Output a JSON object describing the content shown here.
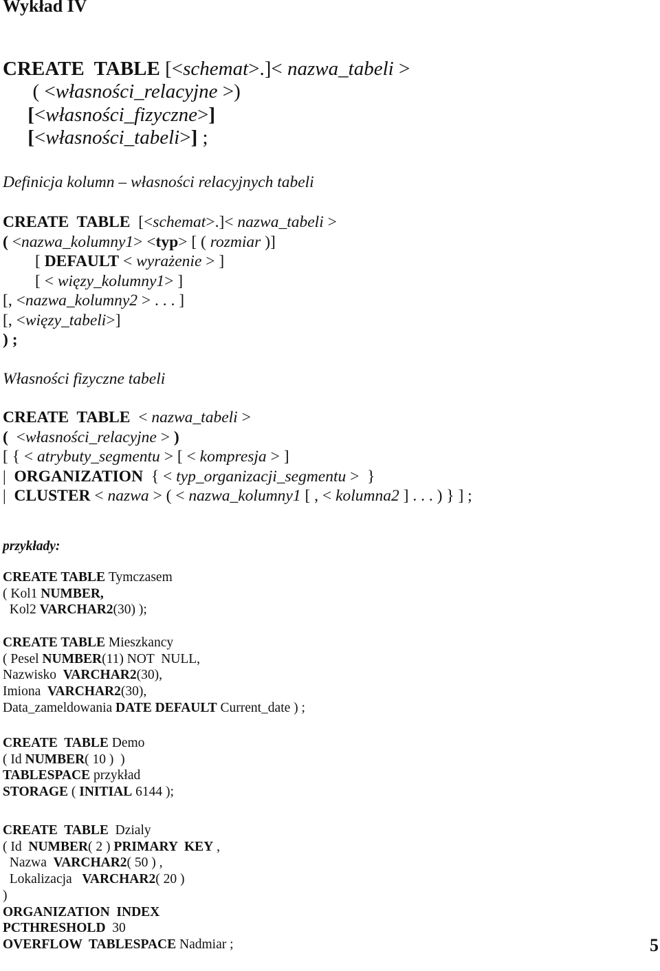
{
  "title": "Wykład IV",
  "page_number": "5",
  "section1": {
    "lines": [
      [
        {
          "t": "CREATE  TABLE ",
          "s": "b"
        },
        {
          "t": "[<",
          "s": ""
        },
        {
          "t": "schemat",
          "s": "i"
        },
        {
          "t": ">.]< ",
          "s": ""
        },
        {
          "t": "nazwa_tabeli",
          "s": "i"
        },
        {
          "t": " >",
          "s": ""
        }
      ],
      [
        {
          "t": "      ( <",
          "s": ""
        },
        {
          "t": "własności_relacyjne",
          "s": "i"
        },
        {
          "t": " >)",
          "s": ""
        }
      ],
      [
        {
          "t": "     [",
          "s": "b"
        },
        {
          "t": "<",
          "s": ""
        },
        {
          "t": "własności_fizyczne",
          "s": "i"
        },
        {
          "t": ">",
          "s": ""
        },
        {
          "t": "]",
          "s": "b"
        }
      ],
      [
        {
          "t": "     [",
          "s": "b"
        },
        {
          "t": "<",
          "s": ""
        },
        {
          "t": "własności_tabeli",
          "s": "i"
        },
        {
          "t": ">",
          "s": ""
        },
        {
          "t": "]",
          "s": "b"
        },
        {
          "t": " ;",
          "s": ""
        }
      ]
    ]
  },
  "section2": {
    "heading": "Definicja kolumn – własności relacyjnych tabeli",
    "lines": [
      [
        {
          "t": "CREATE  TABLE  ",
          "s": "b"
        },
        {
          "t": "[<",
          "s": ""
        },
        {
          "t": "schemat",
          "s": "i"
        },
        {
          "t": ">.]< ",
          "s": ""
        },
        {
          "t": "nazwa_tabeli",
          "s": "i"
        },
        {
          "t": " >",
          "s": ""
        }
      ],
      [
        {
          "t": "( ",
          "s": "b"
        },
        {
          "t": "<",
          "s": ""
        },
        {
          "t": "nazwa_kolumny1",
          "s": "i"
        },
        {
          "t": "> <",
          "s": ""
        },
        {
          "t": "typ",
          "s": "b"
        },
        {
          "t": "> [ ( ",
          "s": ""
        },
        {
          "t": "rozmiar",
          "s": "i"
        },
        {
          "t": " )]",
          "s": ""
        }
      ],
      [
        {
          "t": "        [ ",
          "s": ""
        },
        {
          "t": "DEFAULT",
          "s": "b"
        },
        {
          "t": " < ",
          "s": ""
        },
        {
          "t": "wyrażenie",
          "s": "i"
        },
        {
          "t": " > ]",
          "s": ""
        }
      ],
      [
        {
          "t": "        [ < ",
          "s": ""
        },
        {
          "t": "więzy_kolumny1",
          "s": "i"
        },
        {
          "t": "> ]",
          "s": ""
        }
      ],
      [
        {
          "t": "[, <",
          "s": ""
        },
        {
          "t": "nazwa_kolumny2",
          "s": "i"
        },
        {
          "t": " > . . . ]",
          "s": ""
        }
      ],
      [
        {
          "t": "[, <",
          "s": ""
        },
        {
          "t": "więzy_tabeli",
          "s": "i"
        },
        {
          "t": ">]",
          "s": ""
        }
      ],
      [
        {
          "t": ") ;",
          "s": "b"
        }
      ]
    ]
  },
  "section3": {
    "heading": "Własności fizyczne tabeli",
    "lines": [
      [
        {
          "t": "CREATE  TABLE  ",
          "s": "b"
        },
        {
          "t": "< ",
          "s": ""
        },
        {
          "t": "nazwa_tabeli",
          "s": "i"
        },
        {
          "t": " >",
          "s": ""
        }
      ],
      [
        {
          "t": "(  ",
          "s": "b"
        },
        {
          "t": "<",
          "s": ""
        },
        {
          "t": "własności_relacyjne",
          "s": "i"
        },
        {
          "t": " > ",
          "s": ""
        },
        {
          "t": ")",
          "s": "b"
        }
      ],
      [
        {
          "t": "[ { < ",
          "s": ""
        },
        {
          "t": "atrybuty_segmentu",
          "s": "i"
        },
        {
          "t": " > [ < ",
          "s": ""
        },
        {
          "t": "kompresja",
          "s": "i"
        },
        {
          "t": " > ]",
          "s": ""
        }
      ],
      [
        {
          "t": "|  ",
          "s": ""
        },
        {
          "t": "ORGANIZATION",
          "s": "b"
        },
        {
          "t": "  { < ",
          "s": ""
        },
        {
          "t": "typ_organizacji_segmentu",
          "s": "i"
        },
        {
          "t": " >  }",
          "s": ""
        }
      ],
      [
        {
          "t": "|  ",
          "s": ""
        },
        {
          "t": "CLUSTER",
          "s": "b"
        },
        {
          "t": " < ",
          "s": ""
        },
        {
          "t": "nazwa",
          "s": "i"
        },
        {
          "t": " > ( < ",
          "s": ""
        },
        {
          "t": "nazwa_kolumny1",
          "s": "i"
        },
        {
          "t": " [ , < ",
          "s": ""
        },
        {
          "t": "kolumna2",
          "s": "i"
        },
        {
          "t": " ] . . . ) } ] ;",
          "s": ""
        }
      ]
    ]
  },
  "examples": {
    "heading": "przykłady:",
    "blocks": [
      [
        [
          {
            "t": "CREATE TABLE ",
            "s": "b"
          },
          {
            "t": "Tymczasem",
            "s": ""
          }
        ],
        [
          {
            "t": "( Kol1 ",
            "s": ""
          },
          {
            "t": "NUMBER,",
            "s": "b"
          }
        ],
        [
          {
            "t": "  Kol2 ",
            "s": ""
          },
          {
            "t": "VARCHAR2",
            "s": "b"
          },
          {
            "t": "(30) );",
            "s": ""
          }
        ]
      ],
      [
        [
          {
            "t": "CREATE TABLE ",
            "s": "b"
          },
          {
            "t": "Mieszkancy",
            "s": ""
          }
        ],
        [
          {
            "t": "( Pesel ",
            "s": ""
          },
          {
            "t": "NUMBER",
            "s": "b"
          },
          {
            "t": "(11) NOT  NULL,",
            "s": ""
          }
        ],
        [
          {
            "t": "Nazwisko  ",
            "s": ""
          },
          {
            "t": "VARCHAR2",
            "s": "b"
          },
          {
            "t": "(30),",
            "s": ""
          }
        ],
        [
          {
            "t": "Imiona  ",
            "s": ""
          },
          {
            "t": "VARCHAR2",
            "s": "b"
          },
          {
            "t": "(30),",
            "s": ""
          }
        ],
        [
          {
            "t": "Data_zameldowania ",
            "s": ""
          },
          {
            "t": "DATE DEFAULT",
            "s": "b"
          },
          {
            "t": " Current_date ) ;",
            "s": ""
          }
        ]
      ],
      [
        [
          {
            "t": "CREATE  TABLE ",
            "s": "b"
          },
          {
            "t": "Demo",
            "s": ""
          }
        ],
        [
          {
            "t": "( Id ",
            "s": ""
          },
          {
            "t": "NUMBER",
            "s": "b"
          },
          {
            "t": "( 10 )  )",
            "s": ""
          }
        ],
        [
          {
            "t": "TABLESPACE",
            "s": "b"
          },
          {
            "t": " przykład",
            "s": ""
          }
        ],
        [
          {
            "t": "STORAGE",
            "s": "b"
          },
          {
            "t": " ( ",
            "s": ""
          },
          {
            "t": "INITIAL",
            "s": "b"
          },
          {
            "t": " 6144 );",
            "s": ""
          }
        ]
      ],
      [
        [
          {
            "t": "CREATE  TABLE  ",
            "s": "b"
          },
          {
            "t": "Dzialy",
            "s": ""
          }
        ],
        [
          {
            "t": "( Id  ",
            "s": ""
          },
          {
            "t": "NUMBER",
            "s": "b"
          },
          {
            "t": "( 2 ) ",
            "s": ""
          },
          {
            "t": "PRIMARY  KEY",
            "s": "b"
          },
          {
            "t": " ,",
            "s": ""
          }
        ],
        [
          {
            "t": "  Nazwa  ",
            "s": ""
          },
          {
            "t": "VARCHAR2",
            "s": "b"
          },
          {
            "t": "( 50 ) ,",
            "s": ""
          }
        ],
        [
          {
            "t": "  Lokalizacja   ",
            "s": ""
          },
          {
            "t": "VARCHAR2",
            "s": "b"
          },
          {
            "t": "( 20 )",
            "s": ""
          }
        ],
        [
          {
            "t": ")",
            "s": ""
          }
        ],
        [
          {
            "t": "ORGANIZATION  INDEX",
            "s": "b"
          }
        ],
        [
          {
            "t": "PCTHRESHOLD",
            "s": "b"
          },
          {
            "t": "  30",
            "s": ""
          }
        ],
        [
          {
            "t": "OVERFLOW  TABLESPACE",
            "s": "b"
          },
          {
            "t": " Nadmiar ;",
            "s": ""
          }
        ]
      ]
    ]
  }
}
